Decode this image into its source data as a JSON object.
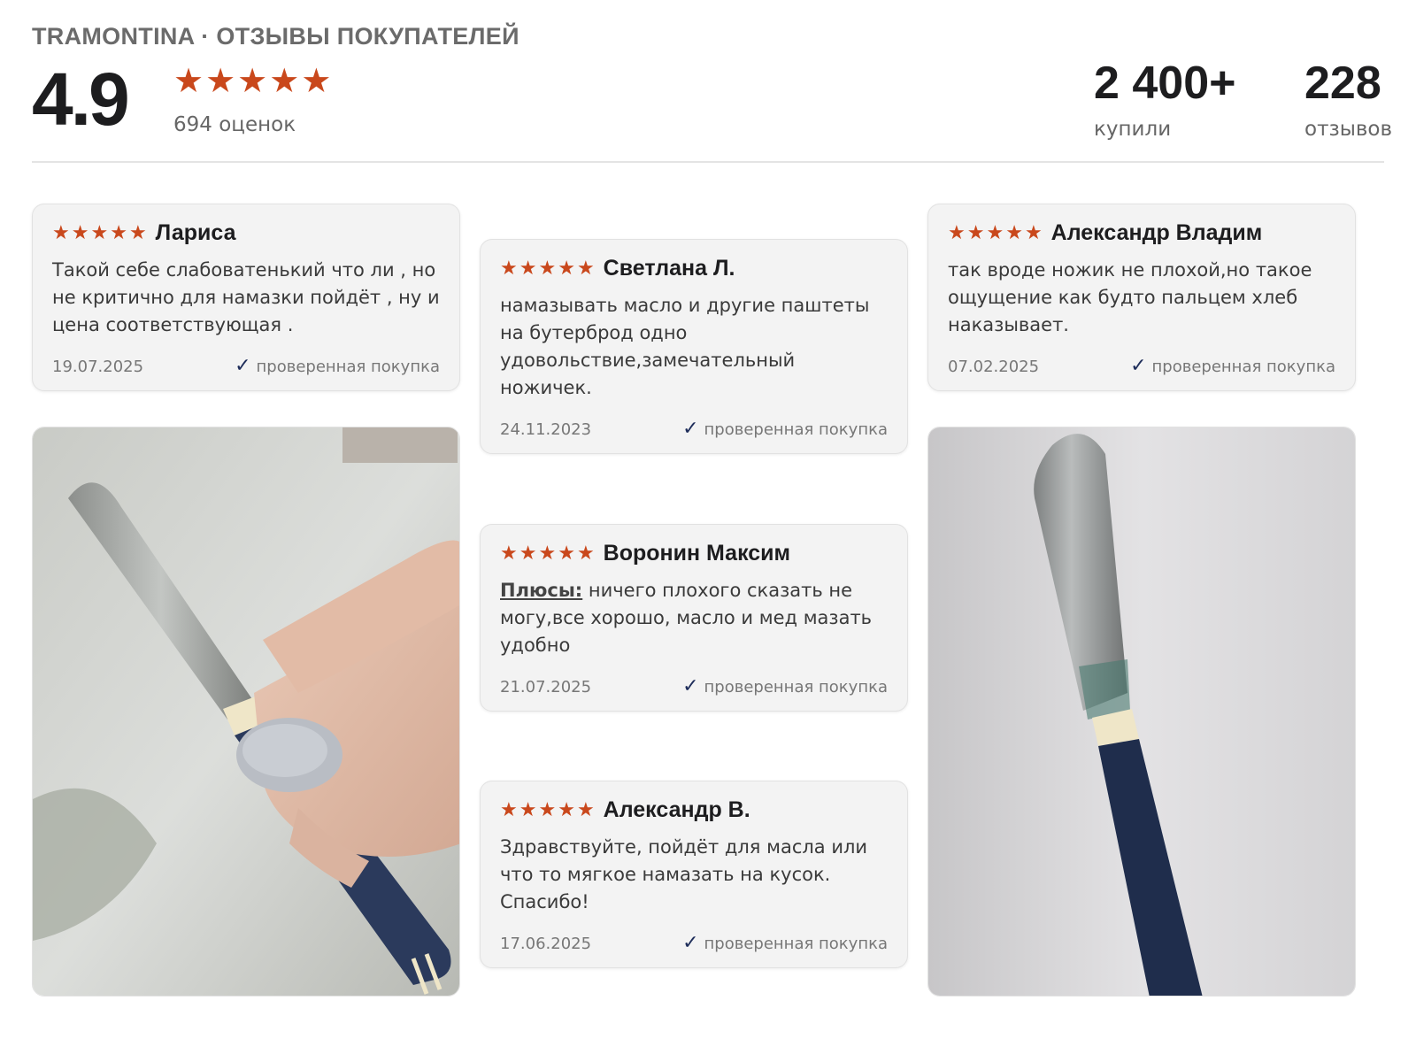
{
  "header": {
    "brand": "TRAMONTINA · ОТЗЫВЫ ПОКУПАТЕЛЕЙ",
    "rating": "4.9",
    "rating_stars": 5,
    "ratings_count": "694 оценок",
    "stats": [
      {
        "value": "2 400+",
        "label": "купили"
      },
      {
        "value": "228",
        "label": "отзывов"
      }
    ]
  },
  "reviews": [
    {
      "author": "Лариса",
      "stars": 5,
      "text": "Такой себе слабоватенький что ли , но не критично для намазки пойдёт , ну и цена соответствующая .",
      "date": "19.07.2025",
      "verified": "проверенная покупка"
    },
    {
      "author": "Светлана Л.",
      "stars": 5,
      "text": "намазывать масло и другие паштеты на бутерброд одно удовольствие,замечательный ножичек.",
      "date": "24.11.2023",
      "verified": "проверенная покупка"
    },
    {
      "author": "Александр Владим",
      "stars": 5,
      "text": "так вроде ножик не плохой,но такое ощущение как будто пальцем хлеб наказывает.",
      "date": "07.02.2025",
      "verified": "проверенная покупка"
    },
    {
      "author": "Воронин Максим",
      "stars": 5,
      "pros_label": "Плюсы:",
      "text": " ничего плохого сказать не могу,все хорошо, масло и мед мазать удобно",
      "date": "21.07.2025",
      "verified": "проверенная покупка"
    },
    {
      "author": "Александр В.",
      "stars": 5,
      "text": "Здравствуйте, пойдёт для масла или что то мягкое намазать на кусок. Спасибо!",
      "date": "17.06.2025",
      "verified": "проверенная покупка"
    }
  ],
  "colors": {
    "star": "#c9481c",
    "check": "#1e2d5a",
    "card_bg": "#f3f3f3"
  },
  "icons": {
    "star": "star-icon",
    "check": "check-icon"
  }
}
